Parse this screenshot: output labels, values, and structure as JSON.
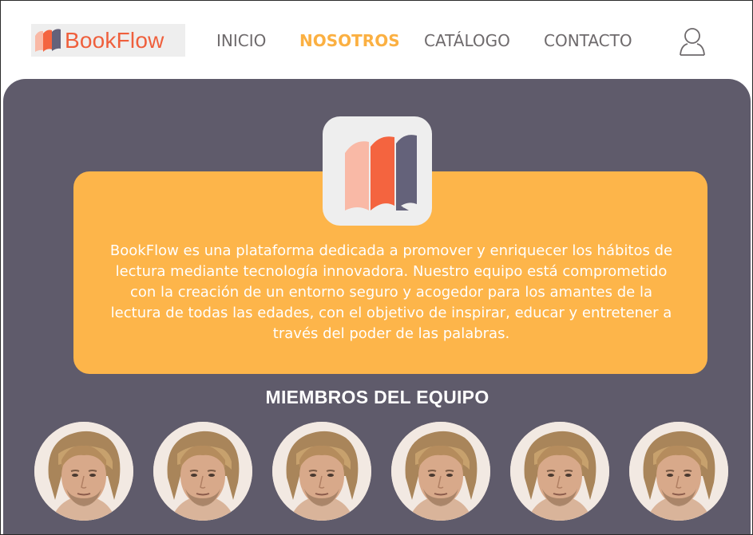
{
  "brand": {
    "name": "BookFlow",
    "accent": "#ef5f3c",
    "logo_colors": [
      "#f9b9a6",
      "#f4643f",
      "#64627a"
    ]
  },
  "nav": {
    "items": [
      {
        "label": "INICIO",
        "active": false
      },
      {
        "label": "NOSOTROS",
        "active": true
      },
      {
        "label": "CATÁLOGO",
        "active": false
      },
      {
        "label": "CONTACTO",
        "active": false
      }
    ],
    "active_color": "#fbb042",
    "user_icon": "user-icon"
  },
  "about": {
    "lines": [
      "BookFlow es una plataforma dedicada a promover y enriquecer los hábitos de",
      "lectura mediante tecnología innovadora. Nuestro equipo está comprometido",
      "con la creación de un entorno  seguro y acogedor para los amantes de la",
      "lectura de todas las edades, con el objetivo de inspirar, educar y entretener a",
      "través del poder de las palabras."
    ],
    "card_color": "#fdb54a"
  },
  "team": {
    "title": "MIEMBROS DEL EQUIPO",
    "member_count": 6,
    "panel_color": "#5f5b6b"
  }
}
